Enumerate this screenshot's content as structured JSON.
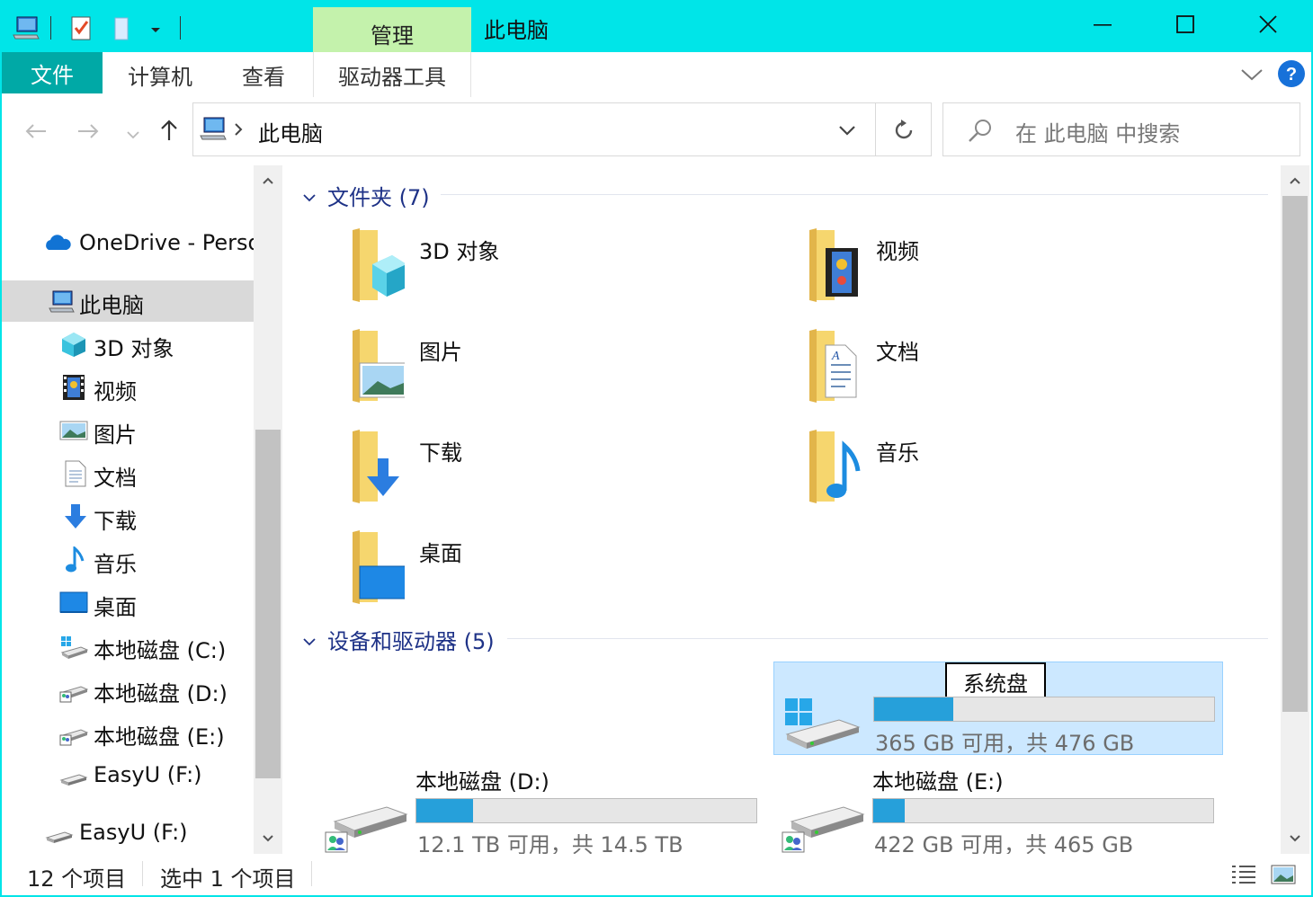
{
  "window": {
    "title": "此电脑",
    "manage_tab": "管理"
  },
  "ribbon": {
    "tabs": [
      "文件",
      "计算机",
      "查看",
      "驱动器工具"
    ]
  },
  "address": {
    "path": "此电脑"
  },
  "search": {
    "placeholder": "在 此电脑 中搜索"
  },
  "nav": {
    "onedrive": "OneDrive - Perso",
    "this_pc": "此电脑",
    "items": [
      "3D 对象",
      "视频",
      "图片",
      "文档",
      "下载",
      "音乐",
      "桌面",
      "本地磁盘 (C:)",
      "本地磁盘 (D:)",
      "本地磁盘 (E:)",
      "EasyU (F:)"
    ],
    "easyu": "EasyU (F:)"
  },
  "folders": {
    "header": "文件夹 (7)",
    "items": [
      "3D 对象",
      "视频",
      "图片",
      "文档",
      "下载",
      "音乐",
      "桌面"
    ]
  },
  "drives": {
    "header": "设备和驱动器 (5)",
    "items": [
      {
        "name": "系统盘",
        "info": "365 GB 可用，共 476 GB",
        "used": 0.233
      },
      {
        "name": "本地磁盘 (D:)",
        "info": "12.1 TB 可用，共 14.5 TB",
        "used": 0.166
      },
      {
        "name": "本地磁盘 (E:)",
        "info": "422 GB 可用，共 465 GB",
        "used": 0.092
      }
    ]
  },
  "status": {
    "count": "12 个项目",
    "selected": "选中 1 个项目"
  },
  "colors": {
    "accent": "#00e5e8",
    "file_tab": "#00a9a6",
    "manage_tab": "#c4f2ac",
    "bar_fill": "#26a0da",
    "selection": "#cce8ff"
  }
}
